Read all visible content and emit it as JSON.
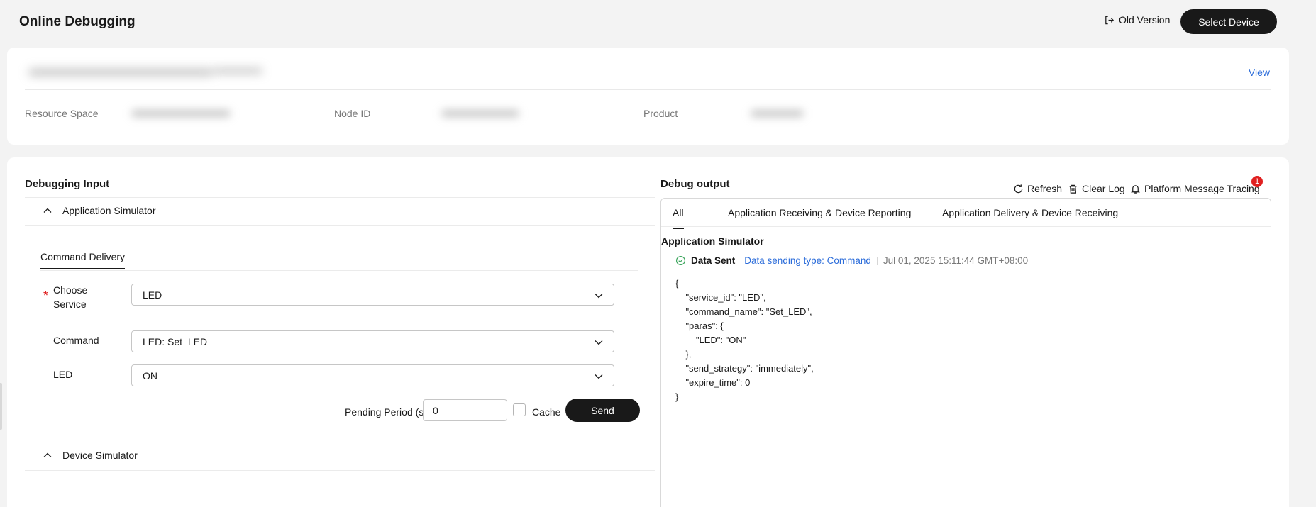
{
  "header": {
    "title": "Online Debugging",
    "old_version_label": "Old Version",
    "select_device_label": "Select Device"
  },
  "device_info": {
    "view_label": "View",
    "fields": [
      {
        "label": "Resource Space"
      },
      {
        "label": "Node ID"
      },
      {
        "label": "Product"
      }
    ]
  },
  "debug_input": {
    "title": "Debugging Input",
    "app_simulator_label": "Application Simulator",
    "tab_label": "Command Delivery",
    "choose_service_label_line1": "Choose",
    "choose_service_label_line2": "Service",
    "choose_service_value": "LED",
    "command_label": "Command",
    "command_value": "LED: Set_LED",
    "led_label": "LED",
    "led_value": "ON",
    "pending_label": "Pending Period (s)",
    "pending_value": "0",
    "cache_label": "Cache",
    "cache_checked": false,
    "send_label": "Send",
    "device_simulator_label": "Device Simulator"
  },
  "debug_output": {
    "title": "Debug output",
    "refresh_label": "Refresh",
    "clear_log_label": "Clear Log",
    "tracing_label": "Platform Message Tracing",
    "tracing_badge": "1",
    "tabs": [
      {
        "label": "All",
        "active": true
      },
      {
        "label": "Application Receiving & Device Reporting",
        "active": false
      },
      {
        "label": "Application Delivery & Device Receiving",
        "active": false
      }
    ],
    "log": {
      "section_title": "Application Simulator",
      "status": "Data Sent",
      "type": "Data sending type: Command",
      "timestamp": "Jul 01, 2025 15:11:44 GMT+08:00",
      "json_text": "{\n    \"service_id\": \"LED\",\n    \"command_name\": \"Set_LED\",\n    \"paras\": {\n        \"LED\": \"ON\"\n    },\n    \"send_strategy\": \"immediately\",\n    \"expire_time\": 0\n}"
    }
  },
  "colors": {
    "accent": "#191919",
    "link": "#2b6cda",
    "success": "#3ba55c",
    "badge": "#e02020",
    "required": "#e02020"
  }
}
